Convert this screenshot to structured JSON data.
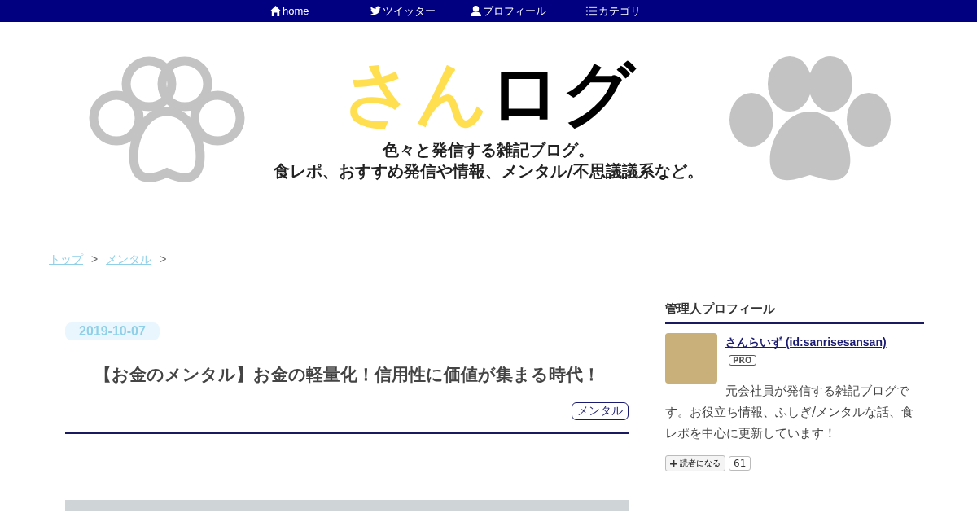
{
  "nav": [
    {
      "label": "home"
    },
    {
      "label": "ツイッター"
    },
    {
      "label": "プロフィール"
    },
    {
      "label": "カテゴリ"
    }
  ],
  "header": {
    "logo_part_1": "さん",
    "logo_part_2": "ログ",
    "tagline_1": "色々と発信する雑記ブログ。",
    "tagline_2": "食レポ、おすすめ発信や情報、メンタル/不思議議系など。"
  },
  "breadcrumb": [
    {
      "label": "トップ",
      "separator": ">"
    },
    {
      "label": "メンタル",
      "separator": ">"
    }
  ],
  "article": {
    "date": "2019-10-07",
    "title": "【お金のメンタル】お金の軽量化！信用性に価値が集まる時代！",
    "category": "メンタル"
  },
  "sidebar": {
    "heading": "管理人プロフィール",
    "name": "さんらいず (id:sanrisesansan)",
    "badge": "PRO",
    "description": "元会社員が発信する雑記ブログです。お役立ち情報、ふしぎ/メンタルな話、食レポを中心に更新しています！",
    "subscribe": "読者になる",
    "count": "61"
  }
}
